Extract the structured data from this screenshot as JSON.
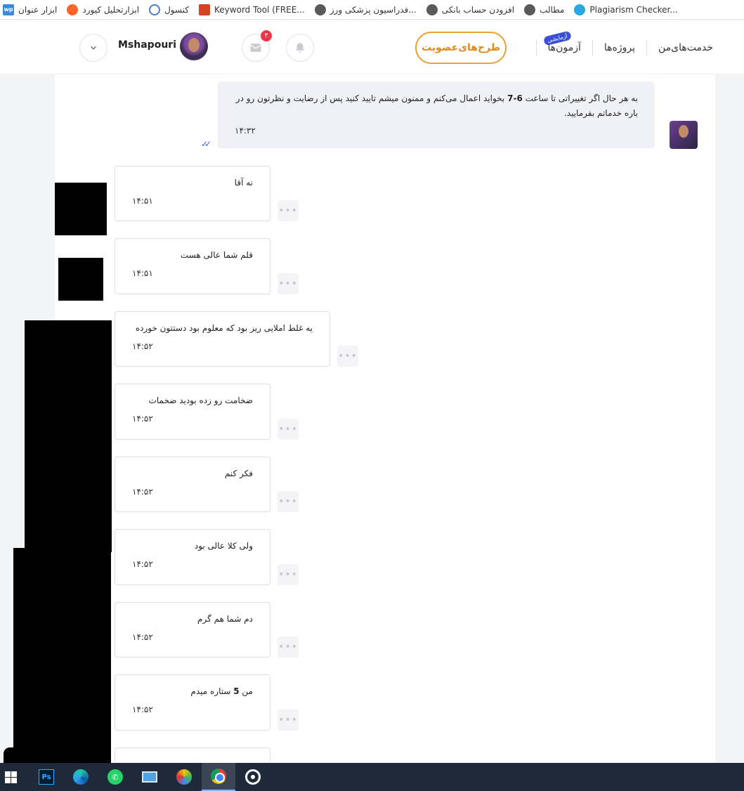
{
  "bookmarks": [
    {
      "label": "ابزار عنوان",
      "icon": "wp-icon"
    },
    {
      "label": "ابزارتحلیل کیورد",
      "icon": "semrush-icon"
    },
    {
      "label": "کنسول",
      "icon": "console-icon"
    },
    {
      "label": "Keyword Tool (FREE...",
      "icon": "keyword-tool-icon"
    },
    {
      "label": "فدراسیون پزشکی ورز...",
      "icon": "globe-icon"
    },
    {
      "label": "افزودن حساب بانکی",
      "icon": "globe-icon"
    },
    {
      "label": "مطالب",
      "icon": "globe-icon"
    },
    {
      "label": "Plagiarism Checker...",
      "icon": "plagiarism-checker-icon"
    }
  ],
  "header": {
    "nav": [
      "خدمت‌های‌من",
      "پروژه‌ها",
      "آزمون‌ها"
    ],
    "new_badge": "آزمایشی",
    "plans_button": "طرح‌های‌عضویت",
    "mail_count": "۳",
    "username": "Mshapouri"
  },
  "own_message": {
    "text_before": "به هر حال اگر تغییراتی تا ساعت ",
    "text_bold": "6-7",
    "text_after": " بخواید اعمال می‌کنم و ممنون میشم تایید کنید پس از رضایت و نظرتون رو در باره خدماتم بفرمایید.",
    "time": "۱۴:۳۲"
  },
  "messages": [
    {
      "text": "نه آقا",
      "time": "۱۴:۵۱"
    },
    {
      "text": "قلم شما عالی هست",
      "time": "۱۴:۵۱"
    },
    {
      "text": "یه غلط املایی ریز بود که معلوم بود دستتون خورده",
      "time": "۱۴:۵۲"
    },
    {
      "text": "ضخامت رو زده بودید ضخمات",
      "time": "۱۴:۵۲"
    },
    {
      "text": "فکر کنم",
      "time": "۱۴:۵۲"
    },
    {
      "text": "ولی کلا عالی بود",
      "time": "۱۴:۵۲"
    },
    {
      "text": "دم شما هم گرم",
      "time": "۱۴:۵۲"
    },
    {
      "text_before": "من ",
      "text_bold": "5",
      "text_after": " ستاره میدم",
      "time": "۱۴:۵۲"
    }
  ],
  "more_icon": "•••",
  "colors": {
    "accent": "#e8a23a",
    "brand_blue": "#3b4fd6",
    "badge_red": "#f2364a"
  }
}
